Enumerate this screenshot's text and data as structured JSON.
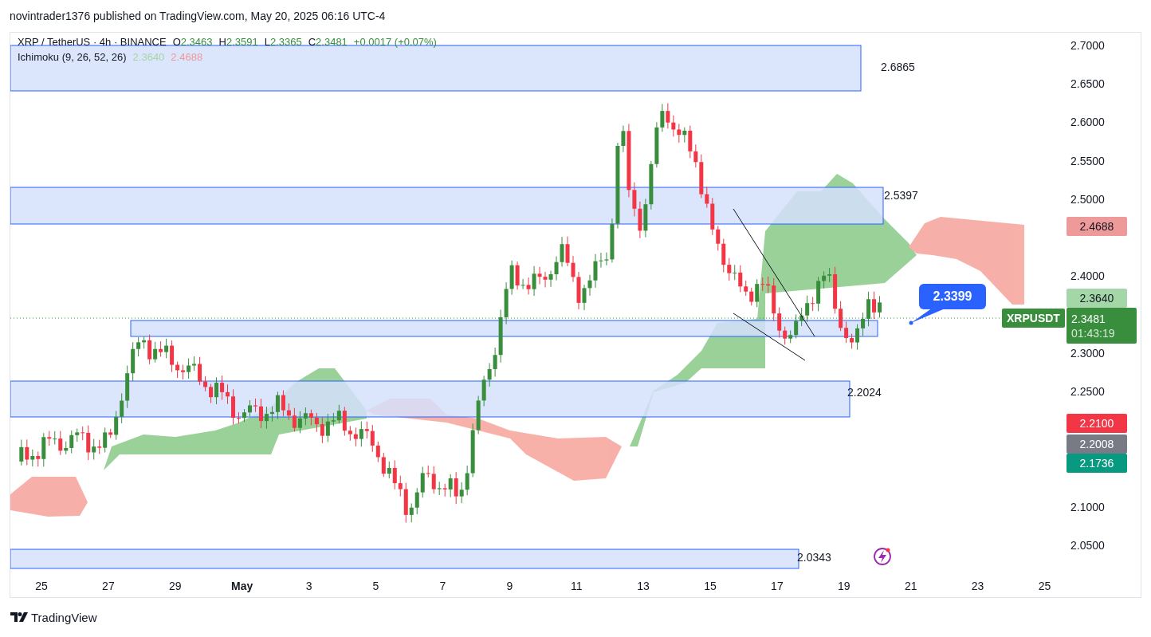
{
  "header": {
    "text": "novintrader1376 published on TradingView.com, May 20, 2025 06:16 UTC-4"
  },
  "legend": {
    "symbol": "XRP / TetherUS · 4h · BINANCE",
    "ohlc": [
      {
        "label": "O",
        "value": "2.3463"
      },
      {
        "label": "H",
        "value": "2.3591"
      },
      {
        "label": "L",
        "value": "2.3365"
      },
      {
        "label": "C",
        "value": "2.3481"
      }
    ],
    "change": "+0.0017 (+0.07%)",
    "indicator": "Ichimoku (9, 26, 52, 26)",
    "indicator_values": [
      {
        "value": "2.3640",
        "color": "#a5d6a7"
      },
      {
        "value": "2.4688",
        "color": "#ef9a9a"
      }
    ]
  },
  "zones": [
    {
      "kind": "labeled",
      "label": "2.6865"
    },
    {
      "kind": "labeled",
      "label": "2.5397"
    },
    {
      "kind": "plain"
    },
    {
      "kind": "labeled",
      "label": "2.2024"
    },
    {
      "kind": "labeled",
      "label": "2.0343"
    }
  ],
  "callout": {
    "text": "2.3399"
  },
  "price_axis": {
    "ticks": [
      "2.7000",
      "2.6500",
      "2.6000",
      "2.5500",
      "2.5000",
      "2.4000",
      "2.3000",
      "2.2500",
      "2.1000",
      "2.0500"
    ],
    "badges": [
      {
        "value": "2.4688",
        "color": "#ef9a9a"
      },
      {
        "value": "2.3640",
        "color": "#a5d6a7"
      },
      {
        "value": "2.2100",
        "color": "#f23645"
      },
      {
        "value": "2.2008",
        "color": "#787b86"
      },
      {
        "value": "2.1736",
        "color": "#089981"
      }
    ],
    "last": {
      "symbol": "XRPUSDT",
      "price": "2.3481",
      "countdown": "01:43:19"
    }
  },
  "time_axis": [
    {
      "label": "25",
      "kind": "day"
    },
    {
      "label": "27",
      "kind": "day"
    },
    {
      "label": "29",
      "kind": "day"
    },
    {
      "label": "May",
      "kind": "month"
    },
    {
      "label": "3",
      "kind": "day"
    },
    {
      "label": "5",
      "kind": "day"
    },
    {
      "label": "7",
      "kind": "day"
    },
    {
      "label": "9",
      "kind": "day"
    },
    {
      "label": "11",
      "kind": "day"
    },
    {
      "label": "13",
      "kind": "day"
    },
    {
      "label": "15",
      "kind": "day"
    },
    {
      "label": "17",
      "kind": "day"
    },
    {
      "label": "19",
      "kind": "day"
    },
    {
      "label": "21",
      "kind": "day"
    },
    {
      "label": "23",
      "kind": "day"
    },
    {
      "label": "25",
      "kind": "day"
    }
  ],
  "footer": {
    "brand": "TradingView"
  }
}
